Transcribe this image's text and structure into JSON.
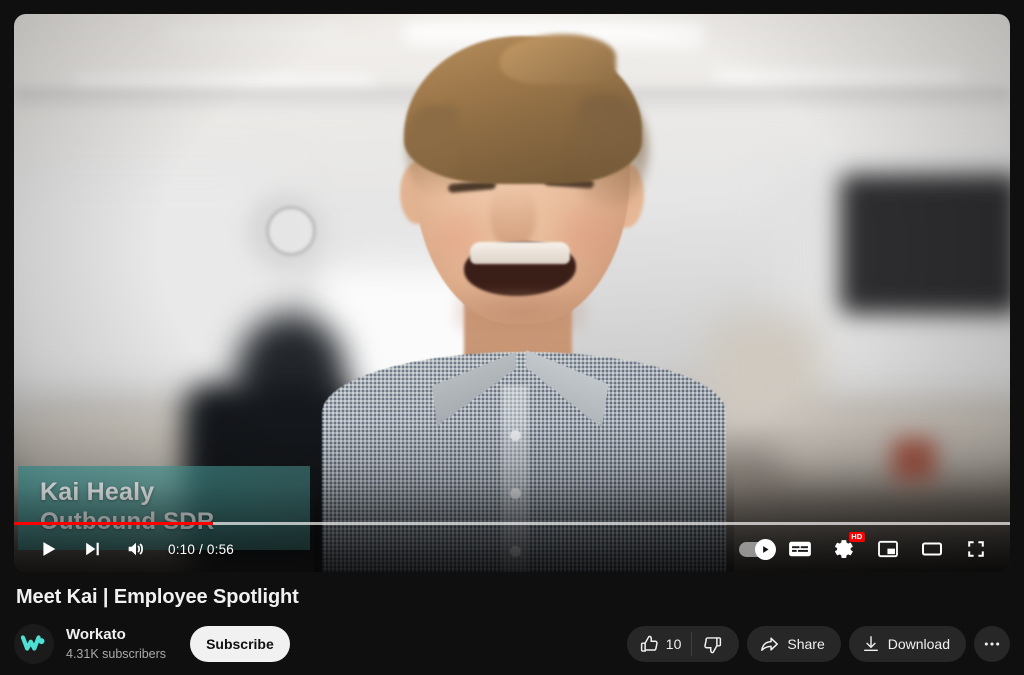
{
  "player": {
    "video_caption": {
      "name": "Kai Healy",
      "role": "Outbound SDR"
    },
    "progress": {
      "percent": 20,
      "buffered_percent": 100,
      "played_color": "#ff0000",
      "buffer_color": "rgba(255,255,255,0.55)",
      "track_color": "rgba(255,255,255,0.28)"
    },
    "controls_left": [
      {
        "name": "play-button",
        "icon": "play-icon",
        "label": "Play"
      },
      {
        "name": "next-button",
        "icon": "next-track-icon",
        "label": "Next"
      },
      {
        "name": "volume-button",
        "icon": "volume-icon",
        "label": "Mute"
      }
    ],
    "time_display": "0:10 / 0:56",
    "current_time": "0:10",
    "duration": "0:56",
    "controls_right": [
      {
        "name": "autoplay-toggle",
        "icon": "autoplay-icon",
        "label": "Autoplay",
        "state": "on"
      },
      {
        "name": "subtitles-button",
        "icon": "subtitles-icon",
        "label": "Subtitles/closed captions"
      },
      {
        "name": "settings-button",
        "icon": "gear-icon",
        "label": "Settings",
        "badge": "HD"
      },
      {
        "name": "miniplayer-button",
        "icon": "miniplayer-icon",
        "label": "Miniplayer"
      },
      {
        "name": "theater-button",
        "icon": "theater-mode-icon",
        "label": "Theater mode"
      },
      {
        "name": "fullscreen-button",
        "icon": "fullscreen-icon",
        "label": "Full screen"
      }
    ],
    "quality_badge": "HD"
  },
  "video": {
    "title": "Meet Kai | Employee Spotlight"
  },
  "channel": {
    "name": "Workato",
    "subscribers": "4.31K subscribers",
    "avatar_letter": "W",
    "avatar_color": "#4fe0d4",
    "subscribe_label": "Subscribe"
  },
  "actions": {
    "like_count": "10",
    "like_label": "Like",
    "dislike_label": "Dislike",
    "share_label": "Share",
    "download_label": "Download",
    "more_label": "More actions"
  },
  "theme": {
    "background": "#0f0f0f",
    "text_primary": "#f1f1f1",
    "text_secondary": "#aaaaaa",
    "pill_background": "#272727",
    "accent_red": "#ff0000"
  }
}
